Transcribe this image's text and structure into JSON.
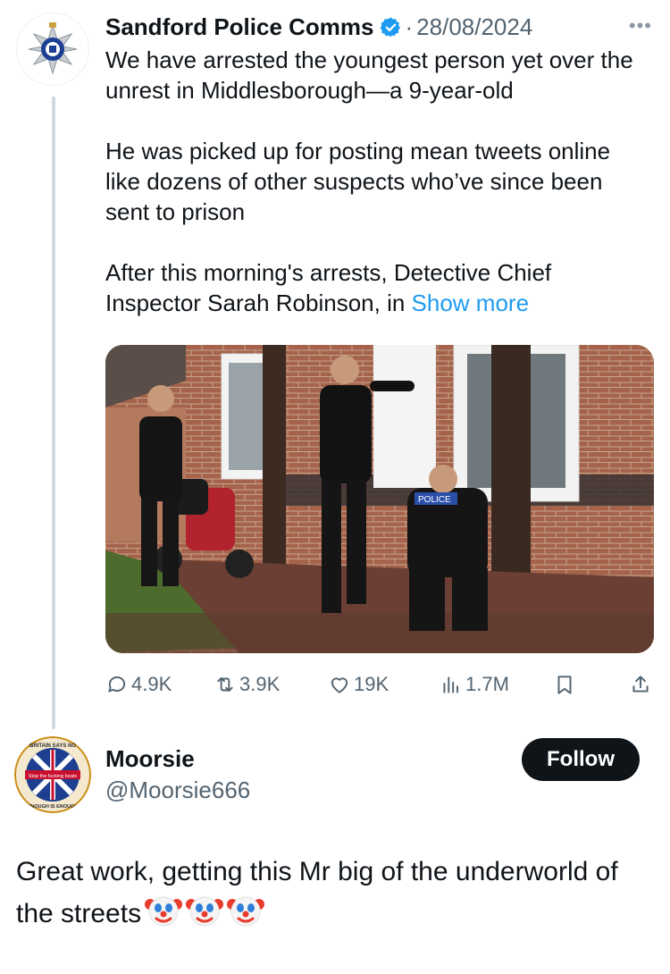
{
  "tweet": {
    "display_name": "Sandford Police Comms",
    "separator": "·",
    "date": "28/08/2024",
    "more_icon": "ellipsis-icon",
    "body": [
      "We have arrested the youngest person yet over the unrest in Middlesborough—a 9-year-old",
      "He was picked up for posting mean tweets online like dozens of other suspects who’ve since been sent to prison",
      "After this morning's arrests, Detective Chief Inspector Sarah Robinson, in "
    ],
    "show_more": "Show more",
    "photo_text": "POLICE",
    "actions": {
      "replies": "4.9K",
      "reposts": "3.9K",
      "likes": "19K",
      "views": "1.7M"
    }
  },
  "reply": {
    "display_name": "Moorsie",
    "handle": "@Moorsie666",
    "follow_label": "Follow",
    "avatar_text": [
      "BRITAIN SAYS NO",
      "Stop the fucking boats",
      "ENOUGH IS ENOUGH"
    ],
    "text": "Great work, getting this Mr big of the underworld of the streets",
    "emoji_count": 3
  },
  "colors": {
    "accent": "#1d9bf0",
    "text": "#0f1419",
    "muted": "#536471",
    "follow_bg": "#0f1419"
  }
}
